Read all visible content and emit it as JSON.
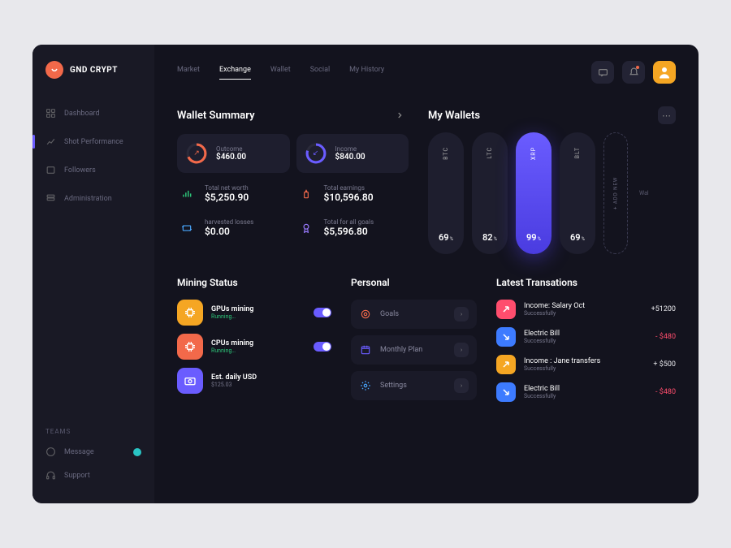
{
  "brand": {
    "name": "GND CRYPT"
  },
  "sidebar": {
    "items": [
      {
        "label": "Dashboard"
      },
      {
        "label": "Shot Performance"
      },
      {
        "label": "Followers"
      },
      {
        "label": "Administration"
      }
    ],
    "teams_label": "TEAMS",
    "bottom": [
      {
        "label": "Message"
      },
      {
        "label": "Support"
      }
    ]
  },
  "topnav": {
    "items": [
      "Market",
      "Exchange",
      "Wallet",
      "Social",
      "My History"
    ],
    "active": "Exchange"
  },
  "wallet_summary": {
    "title": "Wallet Summary",
    "outcome": {
      "label": "Outcome",
      "value": "$460.00"
    },
    "income": {
      "label": "Income",
      "value": "$840.00"
    },
    "stats": [
      {
        "label": "Total net worth",
        "value": "$5,250.90",
        "color": "#2ec77a"
      },
      {
        "label": "Total earnings",
        "value": "$10,596.80",
        "color": "#f2694a"
      },
      {
        "label": "harvested losses",
        "value": "$0.00",
        "color": "#4aa8ff"
      },
      {
        "label": "Total for all goals",
        "value": "$5,596.80",
        "color": "#9a7bff"
      }
    ]
  },
  "wallets": {
    "title": "My Wallets",
    "items": [
      {
        "symbol": "BTC",
        "pct": "69"
      },
      {
        "symbol": "LTC",
        "pct": "82"
      },
      {
        "symbol": "XRP",
        "pct": "99",
        "active": true
      },
      {
        "symbol": "BLT",
        "pct": "69"
      }
    ],
    "add_label": "+ ADD NEW",
    "side_label": "Wal",
    "pct_unit": "%"
  },
  "mining": {
    "title": "Mining Status",
    "items": [
      {
        "title": "GPUs mining",
        "status": "Running…",
        "color": "#f5a623"
      },
      {
        "title": "CPUs mining",
        "status": "Running…",
        "color": "#f2694a"
      },
      {
        "title": "Est. daily USD",
        "sub": "$125.03",
        "color": "#6a5cff"
      }
    ]
  },
  "personal": {
    "title": "Personal",
    "items": [
      {
        "label": "Goals",
        "color": "#f2694a"
      },
      {
        "label": "Monthly Plan",
        "color": "#6a5cff"
      },
      {
        "label": "Settings",
        "color": "#4aa8ff"
      }
    ]
  },
  "transactions": {
    "title": "Latest Transations",
    "items": [
      {
        "title": "Income: Salary Oct",
        "status": "Successfully",
        "amount": "+51200",
        "pos": true,
        "color": "#ff4d6d"
      },
      {
        "title": "Electric Bill",
        "status": "Successfully",
        "amount": "- $480",
        "pos": false,
        "color": "#3d7bff"
      },
      {
        "title": "Income : Jane transfers",
        "status": "Successfully",
        "amount": "+ $500",
        "pos": true,
        "color": "#f5a623"
      },
      {
        "title": "Electric Bill",
        "status": "Successfully",
        "amount": "- $480",
        "pos": false,
        "color": "#3d7bff"
      }
    ]
  }
}
